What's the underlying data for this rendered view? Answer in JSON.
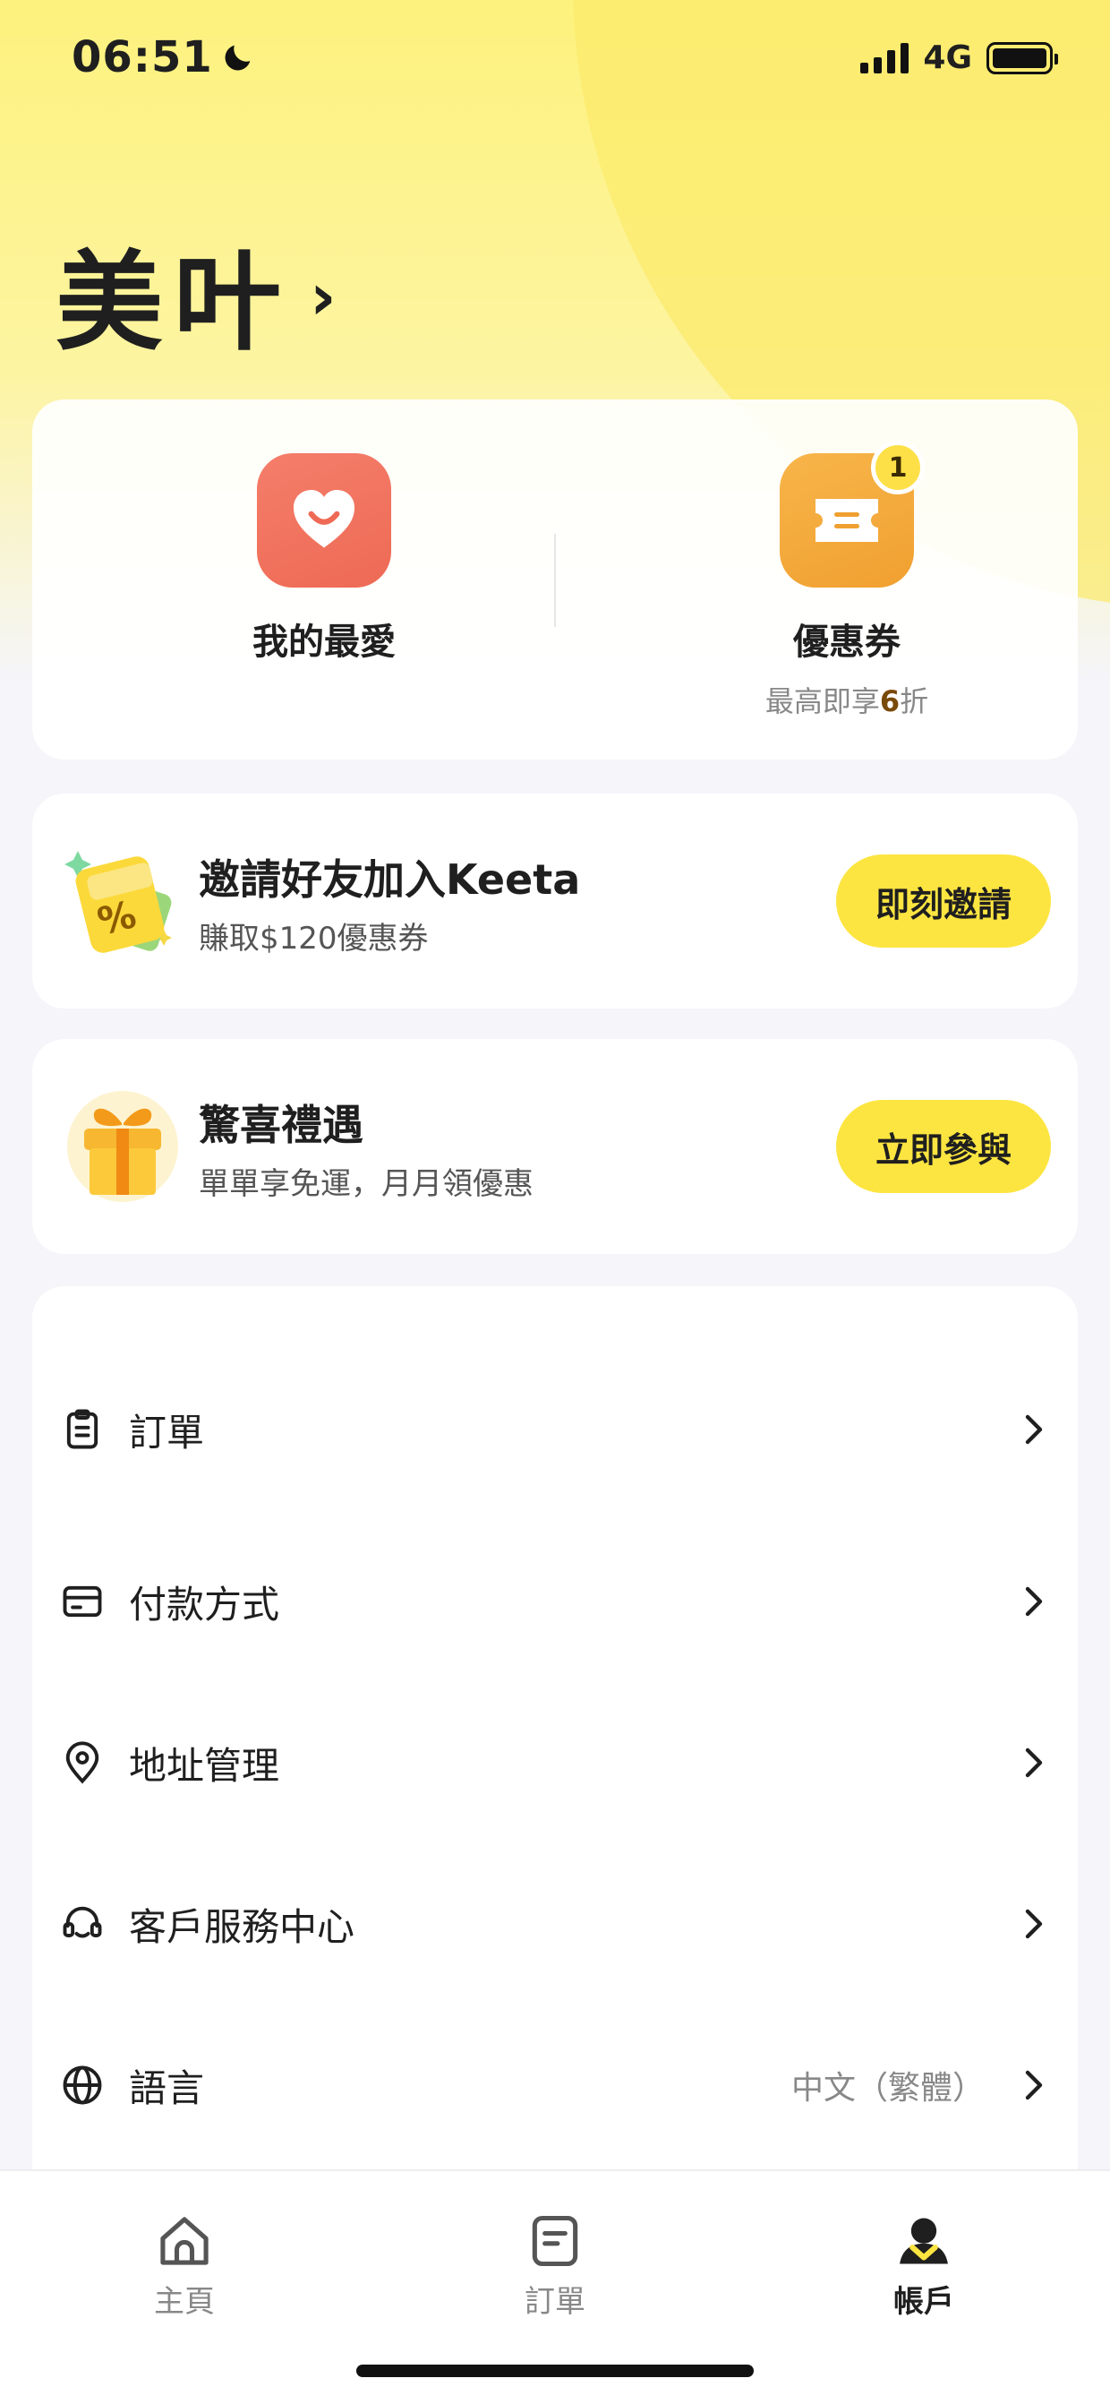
{
  "status_bar": {
    "time": "06:51",
    "network": "4G",
    "icons": [
      "moon-icon",
      "signal-icon",
      "battery-icon"
    ]
  },
  "profile": {
    "name": "美叶"
  },
  "quick_actions": {
    "favorites": {
      "label": "我的最愛",
      "icon": "heart-icon"
    },
    "coupons": {
      "label": "優惠券",
      "icon": "ticket-icon",
      "badge": "1",
      "sub_prefix": "最高即享",
      "sub_highlight": "6",
      "sub_suffix": "折"
    }
  },
  "invite": {
    "title": "邀請好友加入Keeta",
    "subtitle": "賺取$120優惠券",
    "button": "即刻邀請"
  },
  "gift": {
    "title": "驚喜禮遇",
    "subtitle": "單單享免運，月月領優惠",
    "button": "立即參與"
  },
  "menu": {
    "orders": "訂單",
    "payment": "付款方式",
    "address": "地址管理",
    "support": "客戶服務中心",
    "language": "語言",
    "language_value": "中文（繁體）"
  },
  "tabs": {
    "home": "主頁",
    "orders": "訂單",
    "account": "帳戶"
  },
  "colors": {
    "accent": "#fde541",
    "favorite": "#ee6a55",
    "coupon": "#f0a030"
  }
}
